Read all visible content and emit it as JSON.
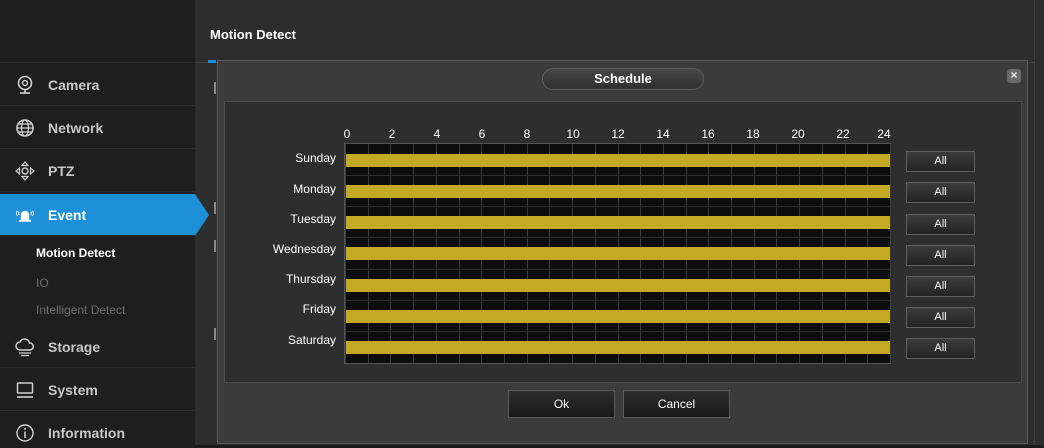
{
  "header": {
    "title": "Motion Detect"
  },
  "sidebar": {
    "items": [
      {
        "label": "Camera",
        "icon": "camera-icon"
      },
      {
        "label": "Network",
        "icon": "network-globe-icon"
      },
      {
        "label": "PTZ",
        "icon": "ptz-icon"
      },
      {
        "label": "Event",
        "icon": "event-alarm-icon",
        "active": true
      },
      {
        "label": "Storage",
        "icon": "storage-cloud-icon"
      },
      {
        "label": "System",
        "icon": "system-monitor-icon"
      },
      {
        "label": "Information",
        "icon": "info-icon"
      }
    ],
    "event_subitems": [
      {
        "label": "Motion Detect",
        "active": true
      },
      {
        "label": "IO",
        "active": false
      },
      {
        "label": "Intelligent Detect",
        "active": false
      }
    ]
  },
  "dialog": {
    "title": "Schedule",
    "close": "×",
    "hours": [
      "0",
      "2",
      "4",
      "6",
      "8",
      "10",
      "12",
      "14",
      "16",
      "18",
      "20",
      "22",
      "24"
    ],
    "days": [
      {
        "name": "Sunday",
        "all_label": "All"
      },
      {
        "name": "Monday",
        "all_label": "All"
      },
      {
        "name": "Tuesday",
        "all_label": "All"
      },
      {
        "name": "Wednesday",
        "all_label": "All"
      },
      {
        "name": "Thursday",
        "all_label": "All"
      },
      {
        "name": "Friday",
        "all_label": "All"
      },
      {
        "name": "Saturday",
        "all_label": "All"
      }
    ],
    "ok_label": "Ok",
    "cancel_label": "Cancel"
  },
  "colors": {
    "accent": "#1e90d8",
    "schedule_fill": "#c3a924",
    "background": "#2d2d2d"
  }
}
